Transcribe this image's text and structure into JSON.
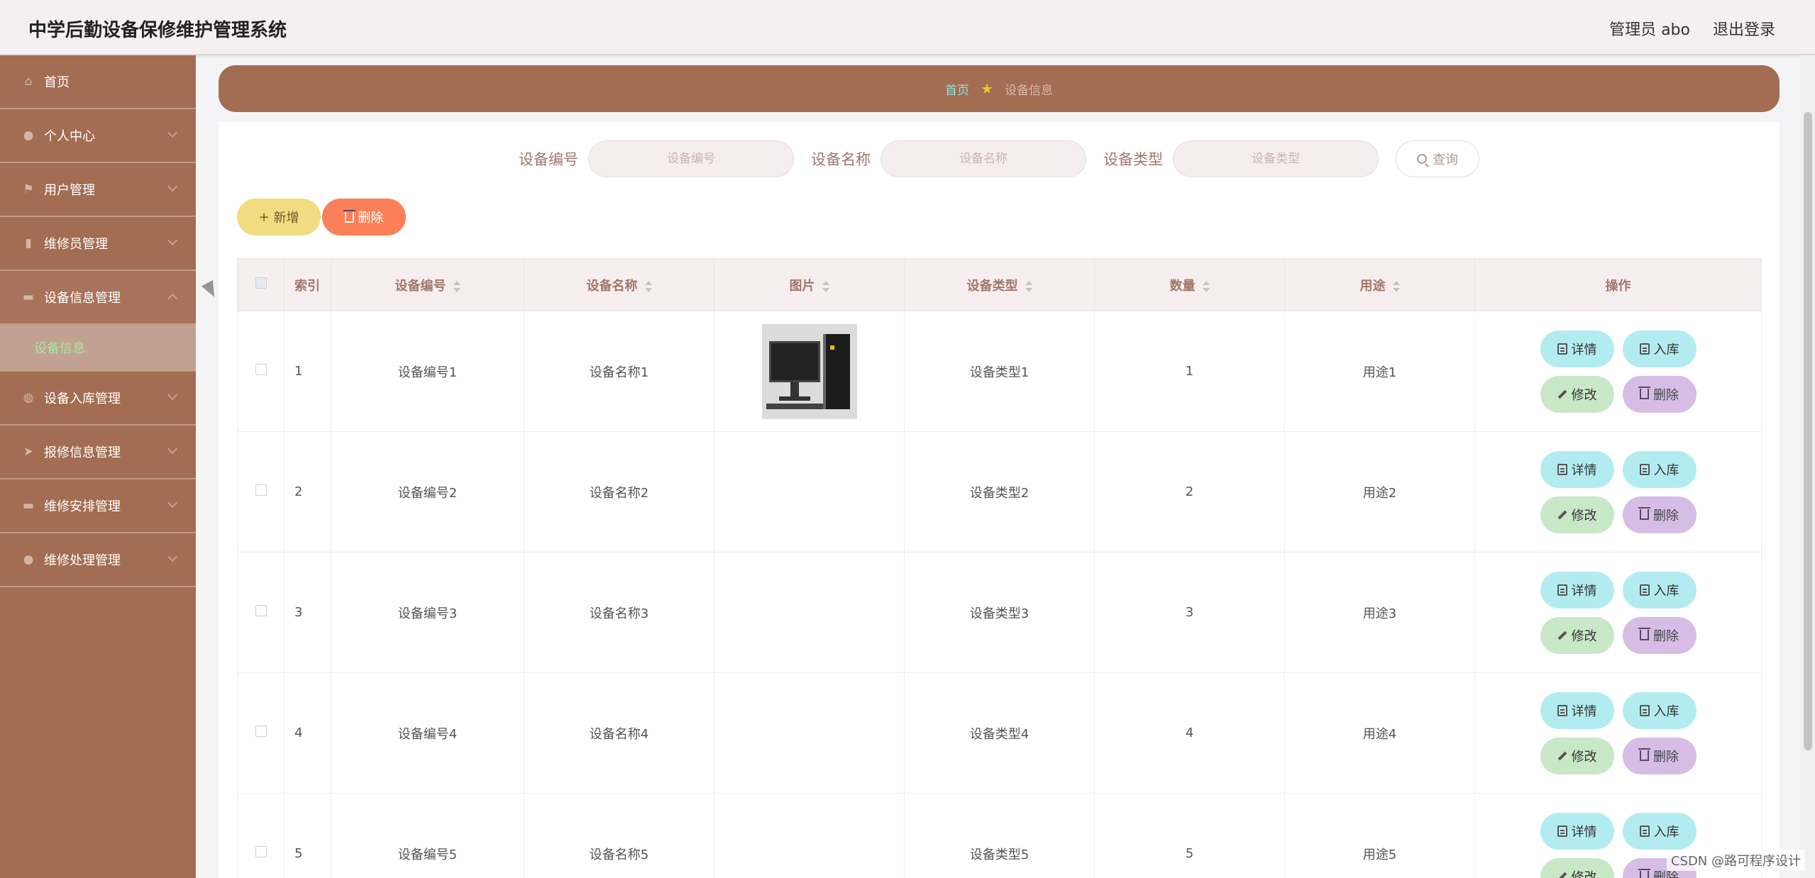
{
  "header": {
    "title": "中学后勤设备保修维护管理系统",
    "user": "管理员 abo",
    "logout": "退出登录"
  },
  "sidebar": {
    "items": [
      {
        "label": "首页",
        "icon": "home-icon"
      },
      {
        "label": "个人中心",
        "icon": "user-icon"
      },
      {
        "label": "用户管理",
        "icon": "flag-icon"
      },
      {
        "label": "维修员管理",
        "icon": "mic-icon"
      },
      {
        "label": "设备信息管理",
        "icon": "monitor-icon"
      },
      {
        "label": "设备入库管理",
        "icon": "globe-icon"
      },
      {
        "label": "报修信息管理",
        "icon": "send-icon"
      },
      {
        "label": "维修安排管理",
        "icon": "message-icon"
      },
      {
        "label": "维修处理管理",
        "icon": "location-icon"
      }
    ],
    "active_sub": "设备信息"
  },
  "breadcrumb": {
    "home": "首页",
    "current": "设备信息"
  },
  "search": {
    "code_label": "设备编号",
    "code_placeholder": "设备编号",
    "name_label": "设备名称",
    "name_placeholder": "设备名称",
    "type_label": "设备类型",
    "type_placeholder": "设备类型",
    "query_btn": "查询"
  },
  "actions": {
    "add": "新增",
    "delete": "删除"
  },
  "table": {
    "headers": [
      "索引",
      "设备编号",
      "设备名称",
      "图片",
      "设备类型",
      "数量",
      "用途",
      "操作"
    ],
    "rows": [
      {
        "index": "1",
        "code": "设备编号1",
        "name": "设备名称1",
        "type": "设备类型1",
        "qty": "1",
        "use": "用途1"
      },
      {
        "index": "2",
        "code": "设备编号2",
        "name": "设备名称2",
        "type": "设备类型2",
        "qty": "2",
        "use": "用途2"
      },
      {
        "index": "3",
        "code": "设备编号3",
        "name": "设备名称3",
        "type": "设备类型3",
        "qty": "3",
        "use": "用途3"
      },
      {
        "index": "4",
        "code": "设备编号4",
        "name": "设备名称4",
        "type": "设备类型4",
        "qty": "4",
        "use": "用途4"
      },
      {
        "index": "5",
        "code": "设备编号5",
        "name": "设备名称5",
        "type": "设备类型5",
        "qty": "5",
        "use": "用途5"
      }
    ],
    "ops": {
      "detail": "详情",
      "in": "入库",
      "edit": "修改",
      "delete": "删除"
    }
  },
  "watermark": "CSDN @路可程序设计"
}
